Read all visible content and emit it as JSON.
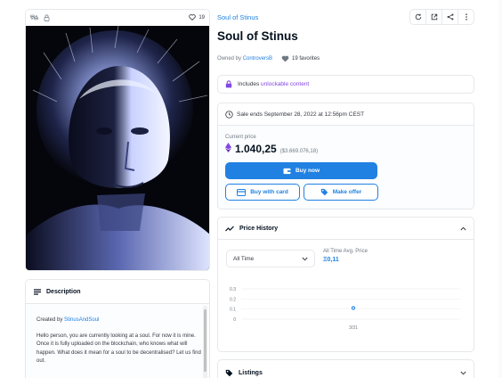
{
  "item": {
    "collection": "Soul of Stinus",
    "title": "Soul of Stinus",
    "owned_by_label": "Owned by",
    "owner": "ControversB",
    "favorites": "19 favorites",
    "favorite_count": "19"
  },
  "unlockable": {
    "prefix": "Includes",
    "link": "unlockable content"
  },
  "sale": {
    "ends_text": "Sale ends September 28, 2022 at 12:56pm CEST",
    "current_price_label": "Current price",
    "price": "1.040,25",
    "usd": "($3.669.076,18)",
    "buy_now": "Buy now",
    "buy_with_card": "Buy with card",
    "make_offer": "Make offer"
  },
  "price_history": {
    "title": "Price History",
    "range": "All Time",
    "avg_label": "All Time Avg. Price",
    "avg_value": "Ξ0,11"
  },
  "chart_data": {
    "type": "scatter",
    "x": [
      "3/31"
    ],
    "y": [
      0.11
    ],
    "yticks": [
      "0.3",
      "0.2",
      "0.1",
      "0"
    ],
    "ylim": [
      0,
      0.3
    ],
    "grid": true
  },
  "description": {
    "title": "Description",
    "created_by_label": "Created by",
    "creator": "StinusAndSoul",
    "text": "Hello person, you are currently looking at a soul. For now it is mine. Once it is fully uploaded on the blockchain, who knows what will happen. What does it mean for a soul to be decentralised? Let us find out."
  },
  "listings": {
    "title": "Listings"
  },
  "colors": {
    "accent": "#2081e2",
    "purple": "#8247e5"
  }
}
